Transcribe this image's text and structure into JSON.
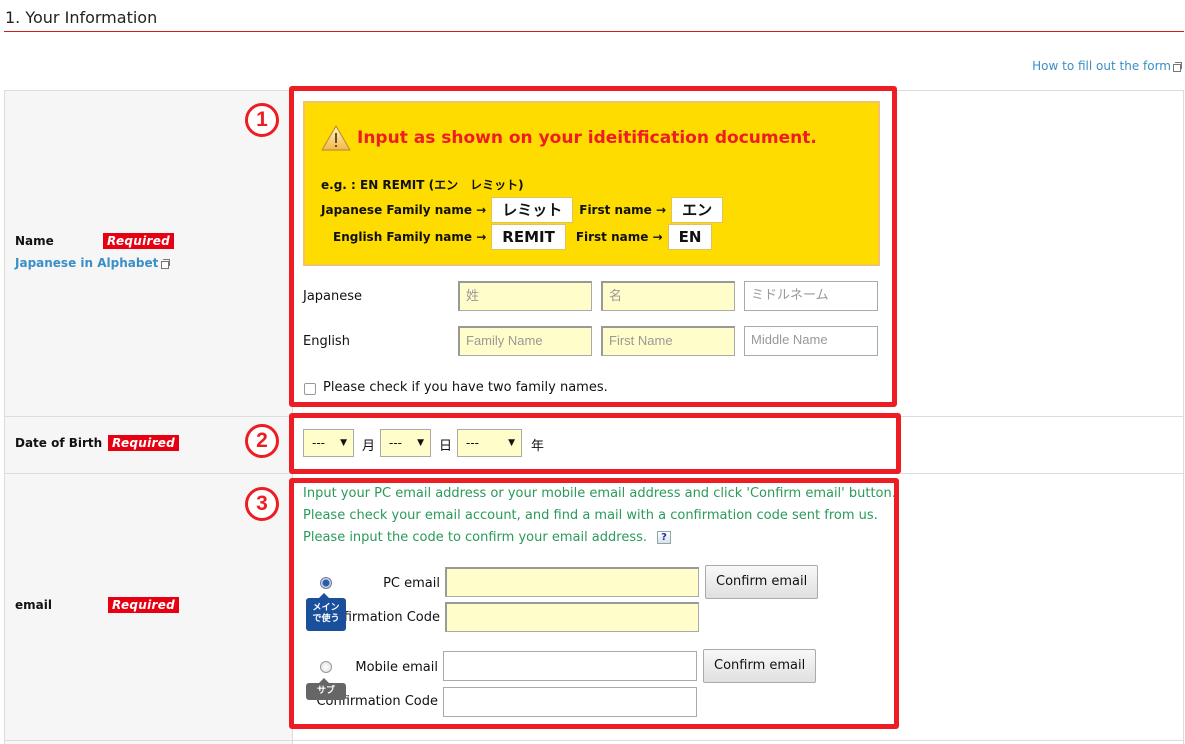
{
  "section": {
    "title": "1. Your Information"
  },
  "howto_link": "How to fill out the form",
  "annotations": [
    "1",
    "2",
    "3"
  ],
  "name_row": {
    "label": "Name",
    "required": "Required",
    "sublink": "Japanese in Alphabet",
    "warning": {
      "title": "Input as shown on your ideitification document.",
      "example": "e.g. :  EN REMIT (エン　レミット)",
      "jp_family_label": "Japanese Family name →",
      "jp_family_value": "レミット",
      "jp_first_label": "First name →",
      "jp_first_value": "エン",
      "en_family_label": "English Family name →",
      "en_family_value": "REMIT",
      "en_first_label": "First name →",
      "en_first_value": "EN"
    },
    "japanese_label": "Japanese",
    "english_label": "English",
    "japanese_placeholders": [
      "姓",
      "名",
      "ミドルネーム"
    ],
    "english_placeholders": [
      "Family Name",
      "First Name",
      "Middle Name"
    ],
    "two_family_names": "Please check if you have two family names."
  },
  "dob_row": {
    "label": "Date of Birth",
    "required": "Required",
    "month_value": "---",
    "month_unit": "月",
    "day_value": "---",
    "day_unit": "日",
    "year_value": "---",
    "year_unit": "年"
  },
  "email_row": {
    "label": "email",
    "required": "Required",
    "instructions": [
      "Input your PC email address or your mobile email address and click 'Confirm email' button.",
      "Please check your account, and find a mail with a confirmation code sent from us.",
      "Please input the code to confirm your email address."
    ],
    "help_icon": "?",
    "pc_email_label": "PC email",
    "pc_code_label": "Confirmation Code",
    "main_tag": "メイン\nで使う",
    "main_tag_line1": "メイン",
    "main_tag_line2": "で使う",
    "mobile_email_label": "Mobile email",
    "mobile_code_label": "Confirmation Code",
    "sub_tag": "サブ",
    "confirm_button": "Confirm email",
    "pc_email_value": "",
    "mobile_email_value": ""
  }
}
